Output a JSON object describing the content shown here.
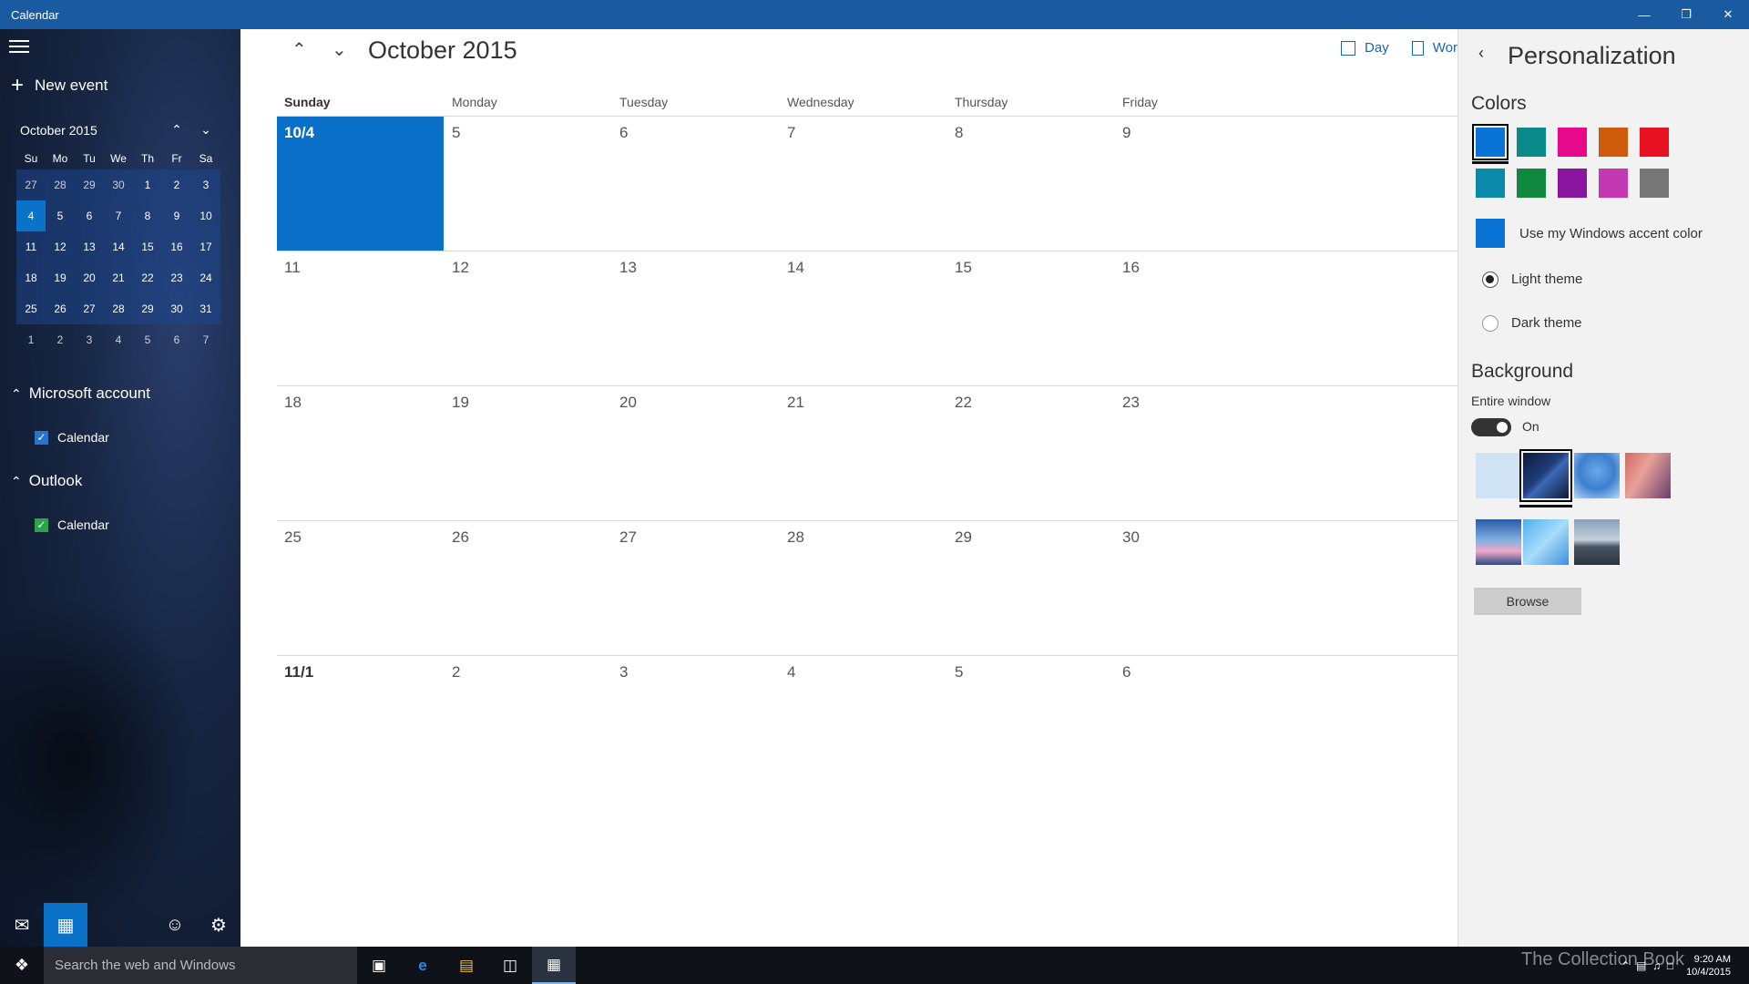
{
  "window": {
    "title": "Calendar"
  },
  "sidebar": {
    "new_event": "New event",
    "mini": {
      "title": "October 2015",
      "dows": [
        "Su",
        "Mo",
        "Tu",
        "We",
        "Th",
        "Fr",
        "Sa"
      ],
      "weeks": [
        [
          "27",
          "28",
          "29",
          "30",
          "1",
          "2",
          "3"
        ],
        [
          "4",
          "5",
          "6",
          "7",
          "8",
          "9",
          "10"
        ],
        [
          "11",
          "12",
          "13",
          "14",
          "15",
          "16",
          "17"
        ],
        [
          "18",
          "19",
          "20",
          "21",
          "22",
          "23",
          "24"
        ],
        [
          "25",
          "26",
          "27",
          "28",
          "29",
          "30",
          "31"
        ],
        [
          "1",
          "2",
          "3",
          "4",
          "5",
          "6",
          "7"
        ]
      ]
    },
    "accounts": [
      {
        "name": "Microsoft account",
        "calendar": "Calendar",
        "color": "#2a73c8"
      },
      {
        "name": "Outlook",
        "calendar": "Calendar",
        "color": "#2ca24a"
      }
    ]
  },
  "main": {
    "title": "October 2015",
    "views": {
      "day": "Day",
      "work": "Wor"
    },
    "dows": [
      "Sunday",
      "Monday",
      "Tuesday",
      "Wednesday",
      "Thursday",
      "Friday"
    ],
    "weeks": [
      [
        "10/4",
        "5",
        "6",
        "7",
        "8",
        "9"
      ],
      [
        "11",
        "12",
        "13",
        "14",
        "15",
        "16"
      ],
      [
        "18",
        "19",
        "20",
        "21",
        "22",
        "23"
      ],
      [
        "25",
        "26",
        "27",
        "28",
        "29",
        "30"
      ],
      [
        "11/1",
        "2",
        "3",
        "4",
        "5",
        "6"
      ]
    ]
  },
  "panel": {
    "title": "Personalization",
    "colors_heading": "Colors",
    "colors": [
      "#0a74d6",
      "#088a8a",
      "#e8088c",
      "#d05a0c",
      "#e81123",
      "#0a8aa8",
      "#10893e",
      "#8a16a0",
      "#c239b3",
      "#767676"
    ],
    "accent_color": "#0a74d6",
    "accent_label": "Use my Windows accent color",
    "light_theme": "Light theme",
    "dark_theme": "Dark theme",
    "background_heading": "Background",
    "entire_window": "Entire window",
    "toggle_label": "On",
    "browse": "Browse"
  },
  "taskbar": {
    "search_placeholder": "Search the web and Windows",
    "watermark": "The Collection Book",
    "time": "9:20 AM",
    "date": "10/4/2015"
  }
}
